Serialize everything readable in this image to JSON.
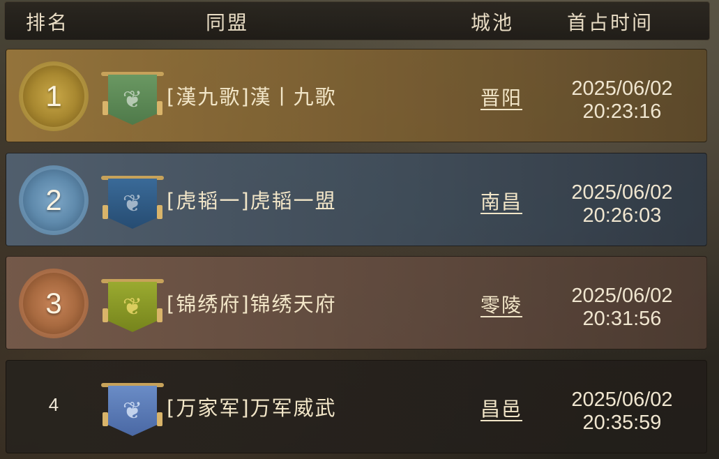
{
  "header": {
    "rank_label": "排名",
    "alliance_label": "同盟",
    "city_label": "城池",
    "time_label": "首占时间"
  },
  "rows": [
    {
      "rank": "1",
      "medal": "gold",
      "banner_color": "#5f8a58",
      "banner_icon": "dragon-emblem-icon",
      "alliance": "[漢九歌]漢丨九歌",
      "city": "晋阳",
      "date": "2025/06/02",
      "time": "20:23:16"
    },
    {
      "rank": "2",
      "medal": "silver",
      "banner_color": "#2e5a86",
      "banner_icon": "dragon-emblem-icon",
      "alliance": "[虎韬一]虎韬一盟",
      "city": "南昌",
      "date": "2025/06/02",
      "time": "20:26:03"
    },
    {
      "rank": "3",
      "medal": "bronze",
      "banner_color": "#8a9a24",
      "banner_icon": "dragon-emblem-icon",
      "alliance": "[锦绣府]锦绣天府",
      "city": "零陵",
      "date": "2025/06/02",
      "time": "20:31:56"
    },
    {
      "rank": "4",
      "medal": "none",
      "banner_color": "#5a7cb8",
      "banner_icon": "dragon-emblem-icon",
      "alliance": "[万家军]万军威武",
      "city": "昌邑",
      "date": "2025/06/02",
      "time": "20:35:59"
    }
  ]
}
